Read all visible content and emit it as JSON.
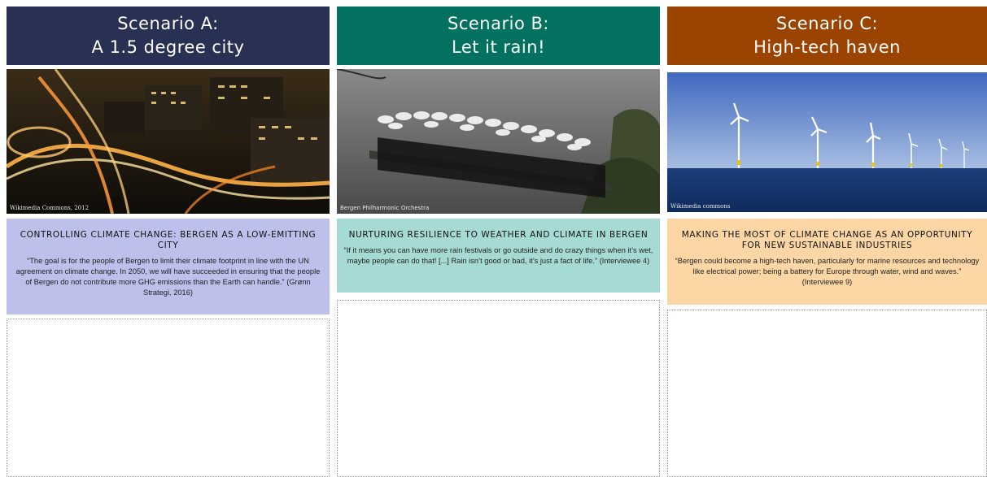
{
  "scenarios": [
    {
      "header_line1": "Scenario A:",
      "header_line2": "A 1.5 degree city",
      "header_color": "#283153",
      "photo_credit": "Wikimedia Commons, 2012",
      "box_title": "CONTROLLING CLIMATE CHANGE: BERGEN AS A LOW-EMITTING CITY",
      "box_quote": "“The goal is for the people of Bergen to limit their climate footprint in line with the UN agreement on climate change. In 2050, we will have succeeded in ensuring that the people of Bergen do not contribute more GHG emissions than the Earth can handle.” (Grønn Strategi, 2016)",
      "box_color": "#bcc0ea"
    },
    {
      "header_line1": "Scenario B:",
      "header_line2": "Let it rain!",
      "header_color": "#03715f",
      "photo_credit": "Bergen Philharmonic Orchestra",
      "box_title": "NURTURING RESILIENCE TO WEATHER AND CLIMATE IN BERGEN",
      "box_quote": "“If it means you can have more rain festivals or go outside and do crazy things when it’s wet, maybe people can do that! [...] Rain isn’t good or bad, it’s just a fact of life.” (Interviewee 4)",
      "box_color": "#a6dbd5"
    },
    {
      "header_line1": "Scenario C:",
      "header_line2": "High-tech haven",
      "header_color": "#9b4300",
      "photo_credit": "Wikimedia commons",
      "box_title": "MAKING THE MOST OF CLIMATE CHANGE AS AN OPPORTUNITY FOR NEW SUSTAINABLE INDUSTRIES",
      "box_quote": "“Bergen could become a high-tech haven, particularly for marine resources and technology like electrical power; being a battery for Europe through water, wind and waves.” (Interviewee 9)",
      "box_color": "#fdd6a6"
    }
  ]
}
